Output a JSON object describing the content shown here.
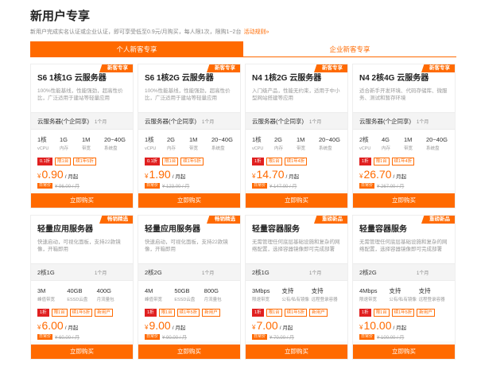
{
  "header": {
    "title": "新用户专享",
    "subtitle": "新用户完成实名认证或企业认证，即可享受低至0.9元/月购买，每人限1次，限购1~2台",
    "rules_link": "活动规则»"
  },
  "tabs": [
    {
      "label": "个人新客专享",
      "active": true
    },
    {
      "label": "企业新客专享",
      "active": false
    }
  ],
  "cards": [
    {
      "badge": "新客专享",
      "title": "S6 1核1G 云服务器",
      "desc": "100%性能基线，性能强劲，超高性价比，广泛适用于建站等轻量应用",
      "spec_label": "云服务器(个企同享)",
      "period": "1个月",
      "specs": [
        {
          "v": "1核",
          "n": "vCPU"
        },
        {
          "v": "1G",
          "n": "内存"
        },
        {
          "v": "1M",
          "n": "带宽"
        },
        {
          "v": "20~40G",
          "n": "系统盘"
        }
      ],
      "tags": [
        "0.1折",
        "限1台",
        "续1年5折"
      ],
      "price": "0.90",
      "unit": "/ 月起",
      "orig_tag": "日常价",
      "orig": "¥ 96.00 / 月",
      "buy": "立即购买"
    },
    {
      "badge": "新客专享",
      "title": "S6 1核2G 云服务器",
      "desc": "100%性能基线，性能强劲，超高性价比，广泛适用于建站等轻量应用",
      "spec_label": "云服务器(个企同享)",
      "period": "1个月",
      "specs": [
        {
          "v": "1核",
          "n": "vCPU"
        },
        {
          "v": "2G",
          "n": "内存"
        },
        {
          "v": "1M",
          "n": "带宽"
        },
        {
          "v": "20~40G",
          "n": "系统盘"
        }
      ],
      "tags": [
        "0.1折",
        "限1台",
        "续1年5折"
      ],
      "price": "1.90",
      "unit": "/ 月起",
      "orig_tag": "日常价",
      "orig": "¥ 123.00 / 月",
      "buy": "立即购买"
    },
    {
      "badge": "新客专享",
      "title": "N4 1核2G 云服务器",
      "desc": "入门级产品，性能无约束，适用于中小型网站搭建等应用",
      "spec_label": "云服务器(个企同享)",
      "period": "1个月",
      "specs": [
        {
          "v": "1核",
          "n": "vCPU"
        },
        {
          "v": "2G",
          "n": "内存"
        },
        {
          "v": "1M",
          "n": "带宽"
        },
        {
          "v": "20~40G",
          "n": "系统盘"
        }
      ],
      "tags": [
        "1折",
        "限1台",
        "续1年4折"
      ],
      "price": "14.70",
      "unit": "/ 月起",
      "orig_tag": "日常价",
      "orig": "¥ 147.00 / 月",
      "buy": "立即购买"
    },
    {
      "badge": "新客专享",
      "title": "N4 2核4G 云服务器",
      "desc": "适合新手开发环境、代码存储库、微服务、测试和暂存环境",
      "spec_label": "云服务器(个企同享)",
      "period": "1个月",
      "specs": [
        {
          "v": "2核",
          "n": "vCPU"
        },
        {
          "v": "4G",
          "n": "内存"
        },
        {
          "v": "1M",
          "n": "带宽"
        },
        {
          "v": "20~40G",
          "n": "系统盘"
        }
      ],
      "tags": [
        "1折",
        "限1台",
        "续1年4折"
      ],
      "price": "26.70",
      "unit": "/ 月起",
      "orig_tag": "日常价",
      "orig": "¥ 267.00 / 月",
      "buy": "立即购买"
    },
    {
      "badge": "畅销精选",
      "title": "轻量应用服务器",
      "desc": "快速启动，可视化面板，支持22款镜像，开箱即用",
      "spec_label": "2核1G",
      "period": "1个月",
      "specs": [
        {
          "v": "3M",
          "n": "峰值带宽"
        },
        {
          "v": "40GB",
          "n": "ESSD云盘"
        },
        {
          "v": "400G",
          "n": "月流量包"
        }
      ],
      "tags": [
        "1折",
        "限1台",
        "续1年5折",
        "新用户"
      ],
      "price": "6.00",
      "unit": "/ 月起",
      "orig_tag": "日常价",
      "orig": "¥ 60.00 / 月",
      "buy": "立即购买"
    },
    {
      "badge": "畅销精选",
      "title": "轻量应用服务器",
      "desc": "快速启动，可视化面板，支持22款镜像，开箱即用",
      "spec_label": "2核2G",
      "period": "1个月",
      "specs": [
        {
          "v": "4M",
          "n": "峰值带宽"
        },
        {
          "v": "50GB",
          "n": "ESSD云盘"
        },
        {
          "v": "800G",
          "n": "月流量包"
        }
      ],
      "tags": [
        "1折",
        "限1台",
        "续1年5折",
        "新用户"
      ],
      "price": "9.00",
      "unit": "/ 月起",
      "orig_tag": "日常价",
      "orig": "¥ 90.00 / 月",
      "buy": "立即购买"
    },
    {
      "badge": "重磅新品",
      "title": "轻量容器服务",
      "desc": "无需管理任何底层基础设施和复杂的网络配置，选择容器镜像即可完成部署",
      "spec_label": "2核1G",
      "period": "1个月",
      "specs": [
        {
          "v": "3Mbps",
          "n": "限速带宽"
        },
        {
          "v": "支持",
          "n": "公有/私有镜像"
        },
        {
          "v": "支持",
          "n": "远程登录容器"
        }
      ],
      "tags": [
        "1折",
        "限1台",
        "续1年5折",
        "新用户"
      ],
      "price": "7.00",
      "unit": "/ 月起",
      "orig_tag": "日常价",
      "orig": "¥ 70.00 / 月",
      "buy": "立即购买"
    },
    {
      "badge": "重磅新品",
      "title": "轻量容器服务",
      "desc": "无需管理任何底层基础设施和复杂的网络配置，选择容器镜像即可完成部署",
      "spec_label": "2核2G",
      "period": "1个月",
      "specs": [
        {
          "v": "4Mbps",
          "n": "限速带宽"
        },
        {
          "v": "支持",
          "n": "公有/私有镜像"
        },
        {
          "v": "支持",
          "n": "远程登录容器"
        }
      ],
      "tags": [
        "1折",
        "限1台",
        "续1年5折",
        "新用户"
      ],
      "price": "10.00",
      "unit": "/ 月起",
      "orig_tag": "日常价",
      "orig": "¥ 100.00 / 月",
      "buy": "立即购买"
    }
  ],
  "yen_symbol": "¥",
  "colors": {
    "accent": "#ff6a00",
    "hot_tag": "#e02020"
  }
}
